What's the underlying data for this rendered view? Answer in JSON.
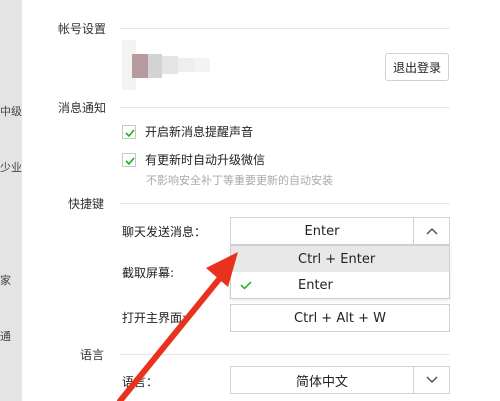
{
  "left_strip": {
    "items": [
      "中级",
      "少业",
      "家",
      "通"
    ]
  },
  "sections": {
    "account": "帐号设置",
    "notify": "消息通知",
    "shortcut": "快捷键",
    "language": "语言"
  },
  "account": {
    "logout_label": "退出登录"
  },
  "notify": {
    "sound_label": "开启新消息提醒声音",
    "sound_checked": true,
    "auto_update_label": "有更新时自动升级微信",
    "auto_update_checked": true,
    "auto_update_hint": "不影响安全补丁等重要更新的自动安装"
  },
  "shortcut": {
    "send_label": "聊天发送消息：",
    "send_value": "Enter",
    "dropdown_options": [
      "Ctrl + Enter",
      "Enter"
    ],
    "dropdown_selected": "Enter",
    "screenshot_label": "截取屏幕:",
    "open_label": "打开主界面:",
    "open_value": "Ctrl + Alt + W"
  },
  "language": {
    "label": "语言：",
    "value": "简体中文"
  },
  "colors": {
    "check": "#1aad19",
    "arrow": "#e8321e"
  },
  "icons": {
    "check": "check-icon",
    "chevron_up": "chevron-up-icon",
    "chevron_down": "chevron-down-icon"
  }
}
